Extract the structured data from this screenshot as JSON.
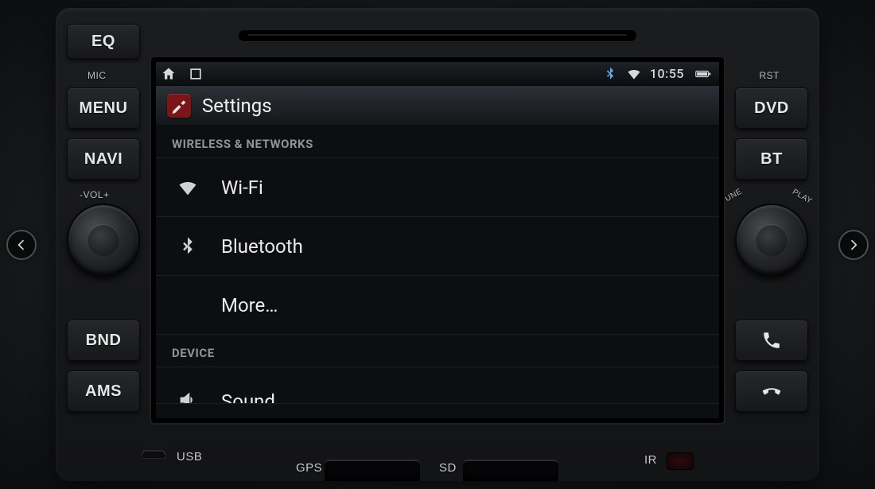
{
  "status": {
    "clock": "10:55",
    "bluetooth_icon": "bluetooth-icon",
    "wifi_icon": "wifi-icon",
    "battery_icon": "battery-icon"
  },
  "app": {
    "title": "Settings"
  },
  "sections": [
    {
      "header": "WIRELESS & NETWORKS",
      "rows": [
        {
          "icon": "wifi-icon",
          "label": "Wi-Fi"
        },
        {
          "icon": "bluetooth-icon",
          "label": "Bluetooth"
        },
        {
          "icon": null,
          "label": "More…"
        }
      ]
    },
    {
      "header": "DEVICE",
      "rows": [
        {
          "icon": "sound-icon",
          "label": "Sound"
        }
      ]
    }
  ],
  "hardware": {
    "left_buttons": {
      "eq": "EQ",
      "menu": "MENU",
      "navi": "NAVI",
      "bnd": "BND",
      "ams": "AMS"
    },
    "right_buttons": {
      "rst": "RST",
      "dvd": "DVD",
      "bt": "BT"
    },
    "left_knob": {
      "label_top": "-VOL+"
    },
    "right_knob": {
      "label_left": "TUNE",
      "label_right": "PLAY"
    },
    "mic_label": "MIC",
    "ports": {
      "usb": "USB",
      "gps": "GPS",
      "sd": "SD",
      "ir": "IR"
    }
  }
}
